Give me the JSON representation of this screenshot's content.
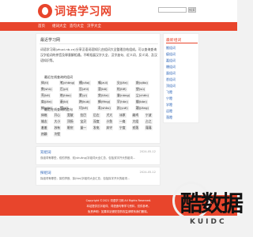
{
  "header": {
    "site_name": "词语学习网",
    "search_placeholder": "",
    "search_button": "搜索"
  },
  "nav": {
    "items": [
      "首页",
      "组词大全",
      "造句大全",
      "汉字大全"
    ]
  },
  "main": {
    "page_title": "最近学习网",
    "intro": "词语学习网(zhuci.nb.cn)分享汉语词语知识,由组词大全整理总结组成。可以查询查询汉字组词的拼音及释意解相通。不断拓展汉字大全、汉字造句、近义词、反义词、及汉语知识等。",
    "recent_search_title": "最近在线查询的组词",
    "recent_words": [
      [
        "体(tǐ)",
        "笔(chǎng)",
        "槽(cǎo)",
        "嘴(zuǐ)",
        "尖(jiān)",
        "敲(qiāo)"
      ],
      [
        "数(shù)",
        "匹(pǐ)",
        "旨(zhǐ)",
        "菠(bō)",
        "帖(tiě)",
        "塑(sù)"
      ],
      [
        "壳(ké)",
        "皓(hào)",
        "蒙(yì)",
        "敛(liǎn)",
        "囊(náng)",
        "尘(chén)"
      ],
      [
        "肩(jiān)",
        "蔽(bì)",
        "跨(kuà)",
        "蜂(fēng)",
        "罕(hǎn)",
        "瓣(bàn)"
      ],
      [
        "搞(gǎo)",
        "惜(xī)",
        "坷(kě)",
        "寿(shòu)",
        "跃(yuè)",
        "疆(jiāng)"
      ]
    ],
    "recent_query_title": "最近在线查询的造句",
    "recent_sentences": [
      [
        "体格",
        "开心",
        "宽敞",
        "拉巴",
        "后左",
        "犬大",
        "冰原",
        "雌鸡",
        "宁波"
      ],
      [
        "雄志",
        "大小",
        "顶扬",
        "宝贝",
        "深度",
        "小鱼",
        "一肩",
        "大组",
        "占之"
      ],
      [
        "羞羞",
        "苏有",
        "眼帘",
        "量一",
        "发电",
        "弃守",
        "宁度",
        "贰落",
        "蔼蔼"
      ],
      [
        "热静",
        "冷壁"
      ]
    ]
  },
  "articles": [
    {
      "title": "双组词",
      "date": "2024-05-12",
      "summary": "双组词有哪些，双的拼音、双(shuāng)字组词大全汇总，包括双字开头的组词..."
    },
    {
      "title": "探组词",
      "date": "2024-05-12",
      "summary": "探组词有哪些，探的拼音、探(tàn)字组词大全汇总，包括探字开头的组词..."
    }
  ],
  "sidebar": {
    "title": "最新组词",
    "items": [
      "搬组词",
      "瘦组词",
      "嘉组词",
      "爆组词",
      "蛋组词",
      "悉组词",
      "顶组词",
      "飞蹬",
      "宁蹬",
      "学蹬",
      "逗蹬",
      "落蹬"
    ]
  },
  "footer": {
    "line1": "Copyright ©2021 词语学习网 All Rights Reserved.",
    "line2": "本站提供汉字组词、词语造句等学习资料，仅供参考。",
    "line3": "免责声明：如果本站侵犯您的权益请联系我们删除。"
  },
  "watermark": {
    "text": "酷数据",
    "sub": "KUIDC"
  },
  "colors": {
    "brand": "#e8452c",
    "link": "#2b63b7",
    "background": "#f2f2f2"
  }
}
